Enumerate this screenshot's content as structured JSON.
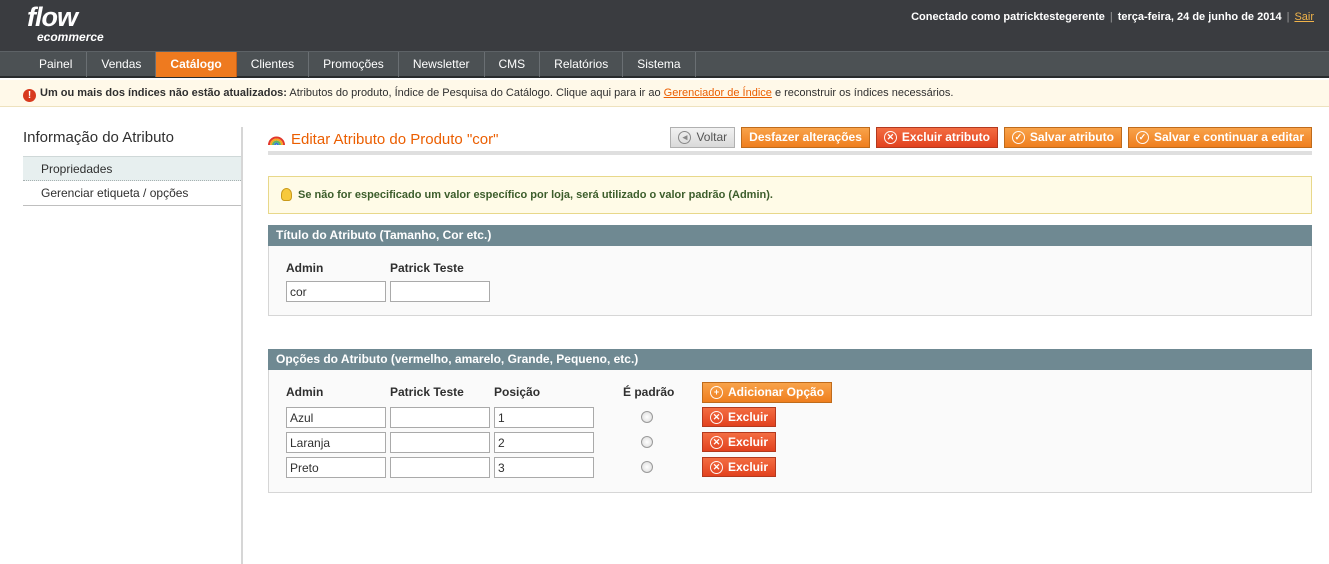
{
  "header": {
    "logo_main": "flow",
    "logo_sub": "ecommerce",
    "user_text": "Conectado como patricktestegerente",
    "date_text": "terça-feira, 24 de junho de 2014",
    "logout_label": "Sair"
  },
  "nav": {
    "items": [
      "Painel",
      "Vendas",
      "Catálogo",
      "Clientes",
      "Promoções",
      "Newsletter",
      "CMS",
      "Relatórios",
      "Sistema"
    ],
    "active": "Catálogo"
  },
  "notice": {
    "bold_text": "Um ou mais dos índices não estão atualizados:",
    "text": " Atributos do produto, Índice de Pesquisa do Catálogo. Clique aqui para ir ao ",
    "link_text": "Gerenciador de Índice",
    "text_after": " e reconstruir os índices necessários."
  },
  "sidebar": {
    "title": "Informação do Atributo",
    "tabs": [
      "Propriedades",
      "Gerenciar etiqueta / opções"
    ]
  },
  "page": {
    "title": "Editar Atributo do Produto \"cor\"",
    "buttons": {
      "back": "Voltar",
      "reset": "Desfazer alterações",
      "delete": "Excluir atributo",
      "save": "Salvar atributo",
      "save_continue": "Salvar e continuar a editar"
    },
    "tip": "Se não for especificado um valor específico por loja, será utilizado o valor padrão (Admin)."
  },
  "title_section": {
    "heading": "Título do Atributo (Tamanho, Cor etc.)",
    "col_admin": "Admin",
    "col_store": "Patrick Teste",
    "admin_value": "cor",
    "store_value": ""
  },
  "options_section": {
    "heading": "Opções do Atributo (vermelho, amarelo, Grande, Pequeno, etc.)",
    "col_admin": "Admin",
    "col_store": "Patrick Teste",
    "col_position": "Posição",
    "col_default": "É padrão",
    "add_label": "Adicionar Opção",
    "delete_label": "Excluir",
    "rows": [
      {
        "admin": "Azul",
        "store": "",
        "position": "1"
      },
      {
        "admin": "Laranja",
        "store": "",
        "position": "2"
      },
      {
        "admin": "Preto",
        "store": "",
        "position": "3"
      }
    ]
  },
  "colors": {
    "accent_orange": "#eb5e00",
    "header_bg": "#3a3c40",
    "section_head_bg": "#6f8992"
  }
}
